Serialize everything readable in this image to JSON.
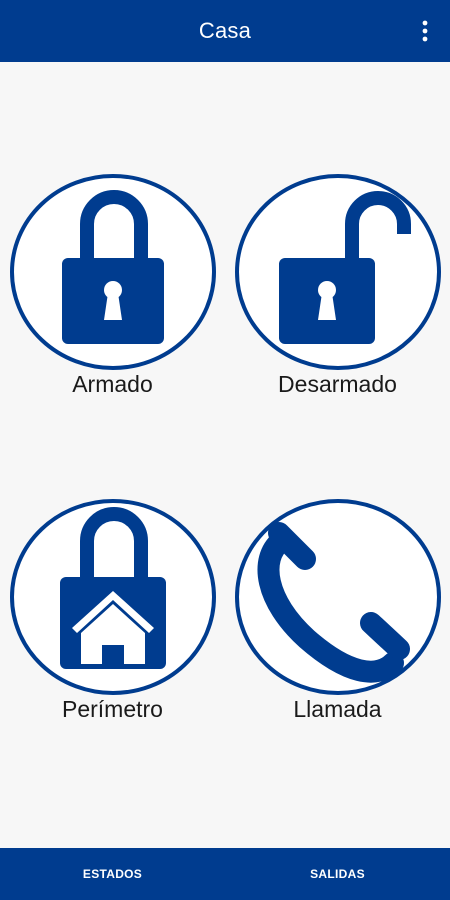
{
  "header": {
    "title": "Casa",
    "more_icon": "more-vert-icon"
  },
  "tiles": [
    {
      "label": "Armado",
      "icon": "lock-closed-icon"
    },
    {
      "label": "Desarmado",
      "icon": "lock-open-icon"
    },
    {
      "label": "Perímetro",
      "icon": "lock-house-icon"
    },
    {
      "label": "Llamada",
      "icon": "phone-icon"
    }
  ],
  "bottom_nav": {
    "items": [
      {
        "label": "ESTADOS"
      },
      {
        "label": "SALIDAS"
      }
    ]
  },
  "colors": {
    "primary": "#003c8f",
    "background": "#f7f7f7",
    "circle_fill": "#ffffff",
    "text": "#1a1a1a"
  }
}
